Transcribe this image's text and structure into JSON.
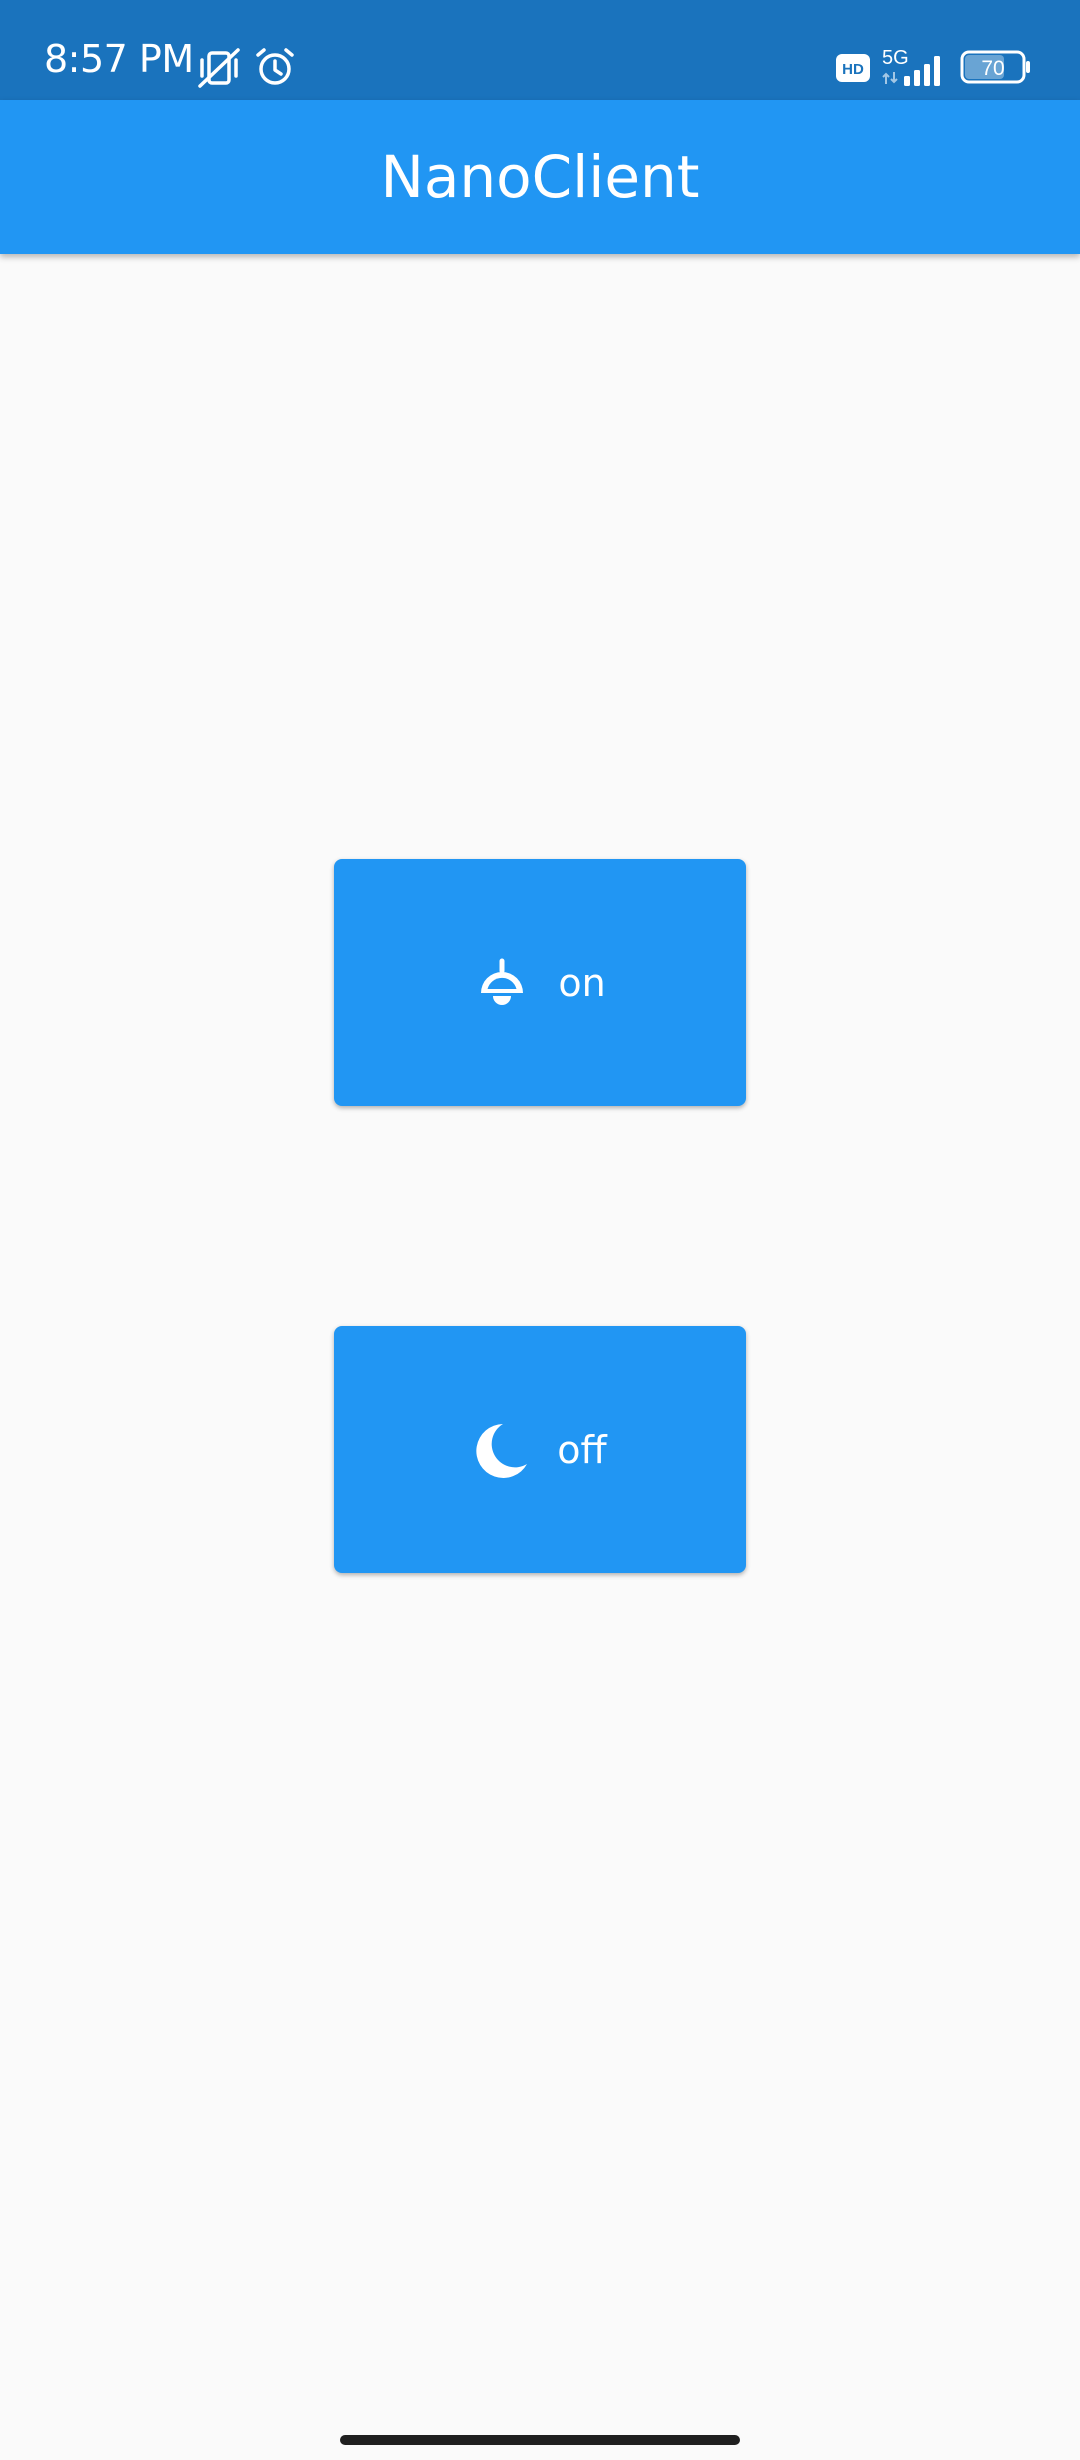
{
  "status_bar": {
    "time": "8:57 PM",
    "network_label": "5G",
    "hd_label": "HD",
    "battery_level": "70",
    "icons": [
      "vibrate-muted-icon",
      "alarm-icon",
      "hd-voice-icon",
      "signal-icon",
      "battery-icon"
    ]
  },
  "app_bar": {
    "title": "NanoClient"
  },
  "buttons": {
    "on": {
      "label": "on",
      "icon": "ceiling-lamp-icon"
    },
    "off": {
      "label": "off",
      "icon": "moon-icon"
    }
  },
  "colors": {
    "status_bar": "#1A73BD",
    "primary": "#2196F3",
    "background": "#FAFAFA",
    "on_primary": "#FFFFFF"
  }
}
